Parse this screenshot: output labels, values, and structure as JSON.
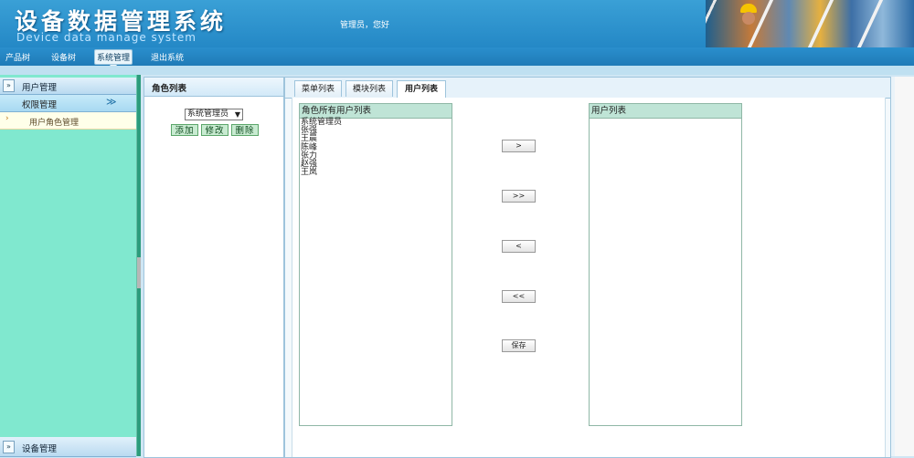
{
  "header": {
    "title": "设备数据管理系统",
    "subtitle": "Device data manage system",
    "greeting": "管理员，您好"
  },
  "nav": {
    "items": [
      {
        "label": "产品树"
      },
      {
        "label": "设备树"
      },
      {
        "label": "系统管理"
      },
      {
        "label": "退出系统"
      }
    ],
    "active_index": 2
  },
  "sidebar": {
    "user_mgmt": "用户管理",
    "permission_mgmt": "权限管理",
    "user_role_mgmt": "用户角色管理",
    "device_mgmt": "设备管理",
    "expand_glyph": "»",
    "sub_arrow": "≫"
  },
  "role_panel": {
    "title": "角色列表",
    "selected_role": "系统管理员",
    "buttons": {
      "add": "添加",
      "edit": "修改",
      "delete": "删除"
    }
  },
  "tabs": [
    {
      "label": "菜单列表"
    },
    {
      "label": "模块列表"
    },
    {
      "label": "用户列表"
    }
  ],
  "active_tab": 2,
  "role_users": {
    "title": "角色所有用户列表",
    "items": [
      "系统管理员",
      "张强",
      "王晨",
      "陈峰",
      "张力",
      "赵强",
      "王岚"
    ]
  },
  "all_users": {
    "title": "用户列表"
  },
  "transfer_buttons": {
    "move_right": ">",
    "move_all_right": ">>",
    "move_left": "<",
    "move_all_left": "<<",
    "save": "保存"
  }
}
